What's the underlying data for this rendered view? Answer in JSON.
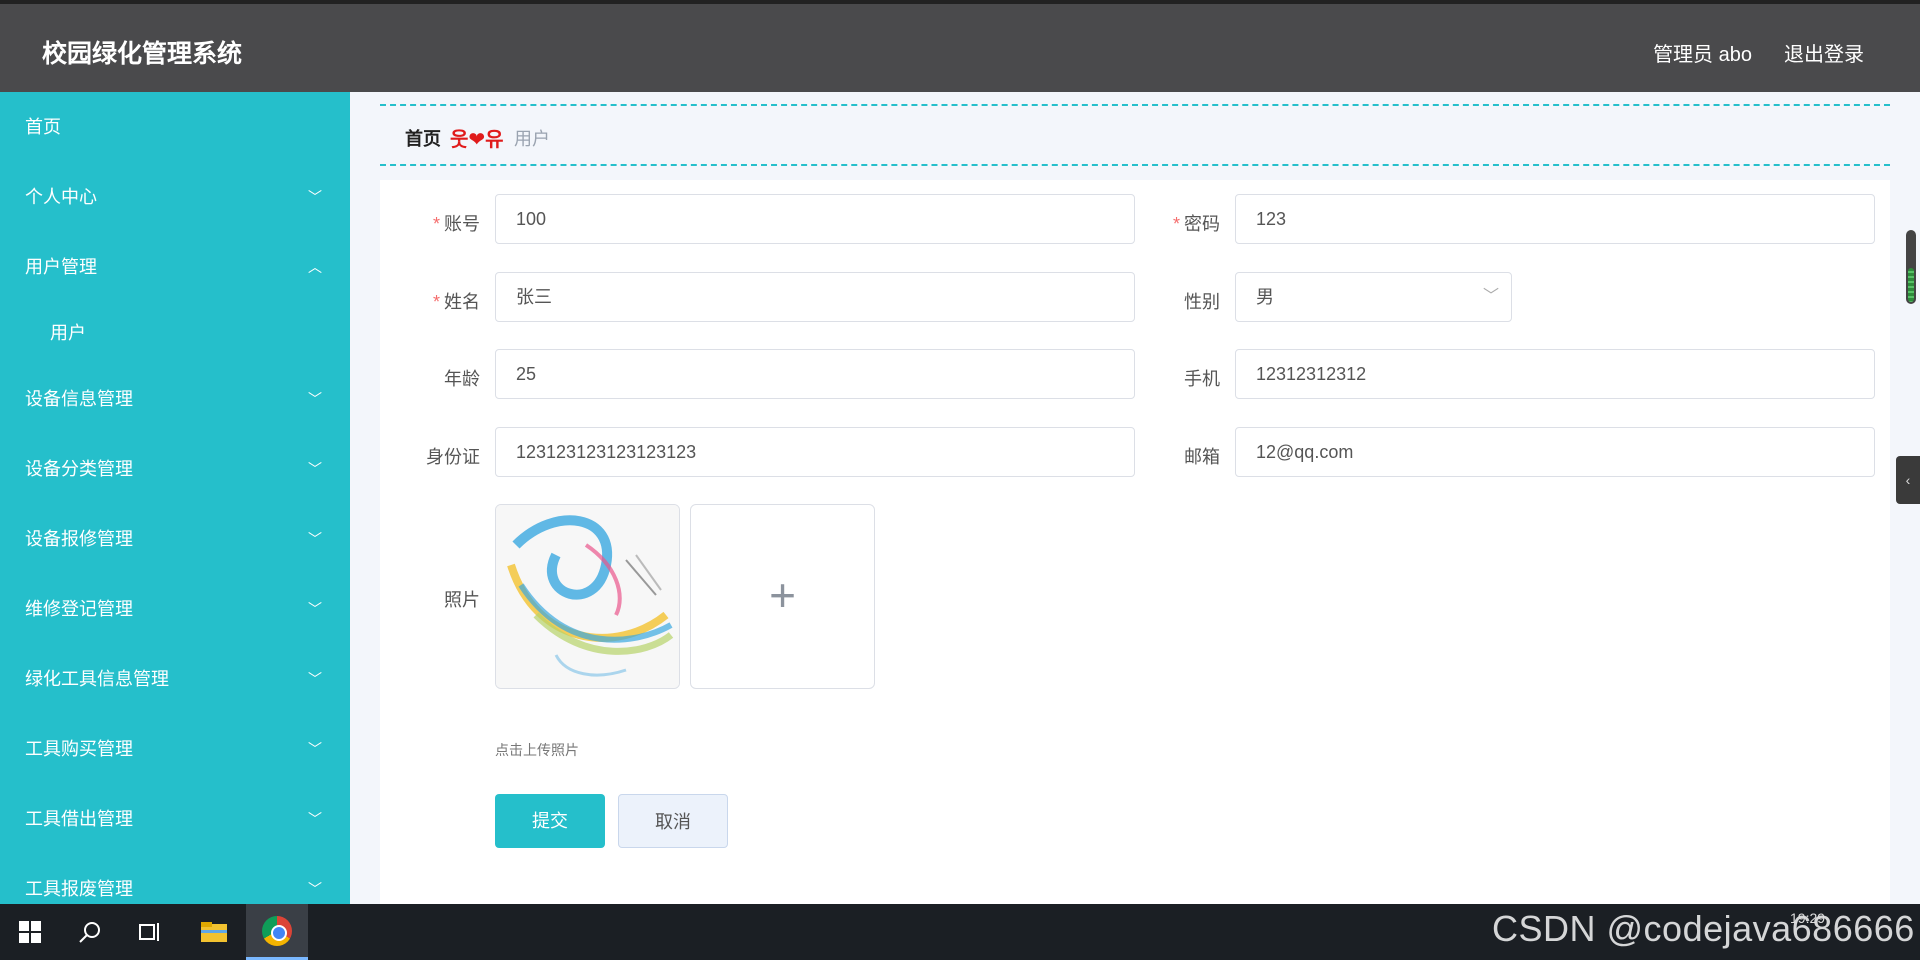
{
  "header": {
    "app_title": "校园绿化管理系统",
    "user_label": "管理员 abo",
    "logout_label": "退出登录"
  },
  "sidebar": {
    "items": [
      {
        "label": "首页",
        "expandable": false
      },
      {
        "label": "个人中心",
        "expandable": true,
        "chevron": "down"
      },
      {
        "label": "用户管理",
        "expandable": true,
        "chevron": "up",
        "children": [
          "用户"
        ]
      },
      {
        "label": "设备信息管理",
        "expandable": true,
        "chevron": "down"
      },
      {
        "label": "设备分类管理",
        "expandable": true,
        "chevron": "down"
      },
      {
        "label": "设备报修管理",
        "expandable": true,
        "chevron": "down"
      },
      {
        "label": "维修登记管理",
        "expandable": true,
        "chevron": "down"
      },
      {
        "label": "绿化工具信息管理",
        "expandable": true,
        "chevron": "down"
      },
      {
        "label": "工具购买管理",
        "expandable": true,
        "chevron": "down"
      },
      {
        "label": "工具借出管理",
        "expandable": true,
        "chevron": "down"
      },
      {
        "label": "工具报废管理",
        "expandable": true,
        "chevron": "down"
      }
    ]
  },
  "breadcrumb": {
    "home": "首页",
    "separator": "웃❤유",
    "current": "用户"
  },
  "form": {
    "account": {
      "label": "账号",
      "value": "100",
      "required": true
    },
    "password": {
      "label": "密码",
      "value": "123",
      "required": true
    },
    "name": {
      "label": "姓名",
      "value": "张三",
      "required": true
    },
    "gender": {
      "label": "性别",
      "value": "男",
      "required": false
    },
    "age": {
      "label": "年龄",
      "value": "25",
      "required": false
    },
    "phone": {
      "label": "手机",
      "value": "12312312312",
      "required": false
    },
    "id_card": {
      "label": "身份证",
      "value": "123123123123123123",
      "required": false
    },
    "email": {
      "label": "邮箱",
      "value": "12@qq.com",
      "required": false
    },
    "photo": {
      "label": "照片",
      "upload_hint": "点击上传照片",
      "upload_icon": "plus-icon"
    },
    "required_mark": "*",
    "submit_label": "提交",
    "cancel_label": "取消"
  },
  "taskbar": {
    "icons": [
      "windows-start-icon",
      "search-icon",
      "task-view-icon",
      "file-explorer-icon",
      "chrome-icon"
    ],
    "watermark": "CSDN @codejava686666",
    "clock": "19:29"
  },
  "colors": {
    "accent": "#25bfcb",
    "header_bg": "#4a4a4c",
    "required": "#f56c6c"
  }
}
